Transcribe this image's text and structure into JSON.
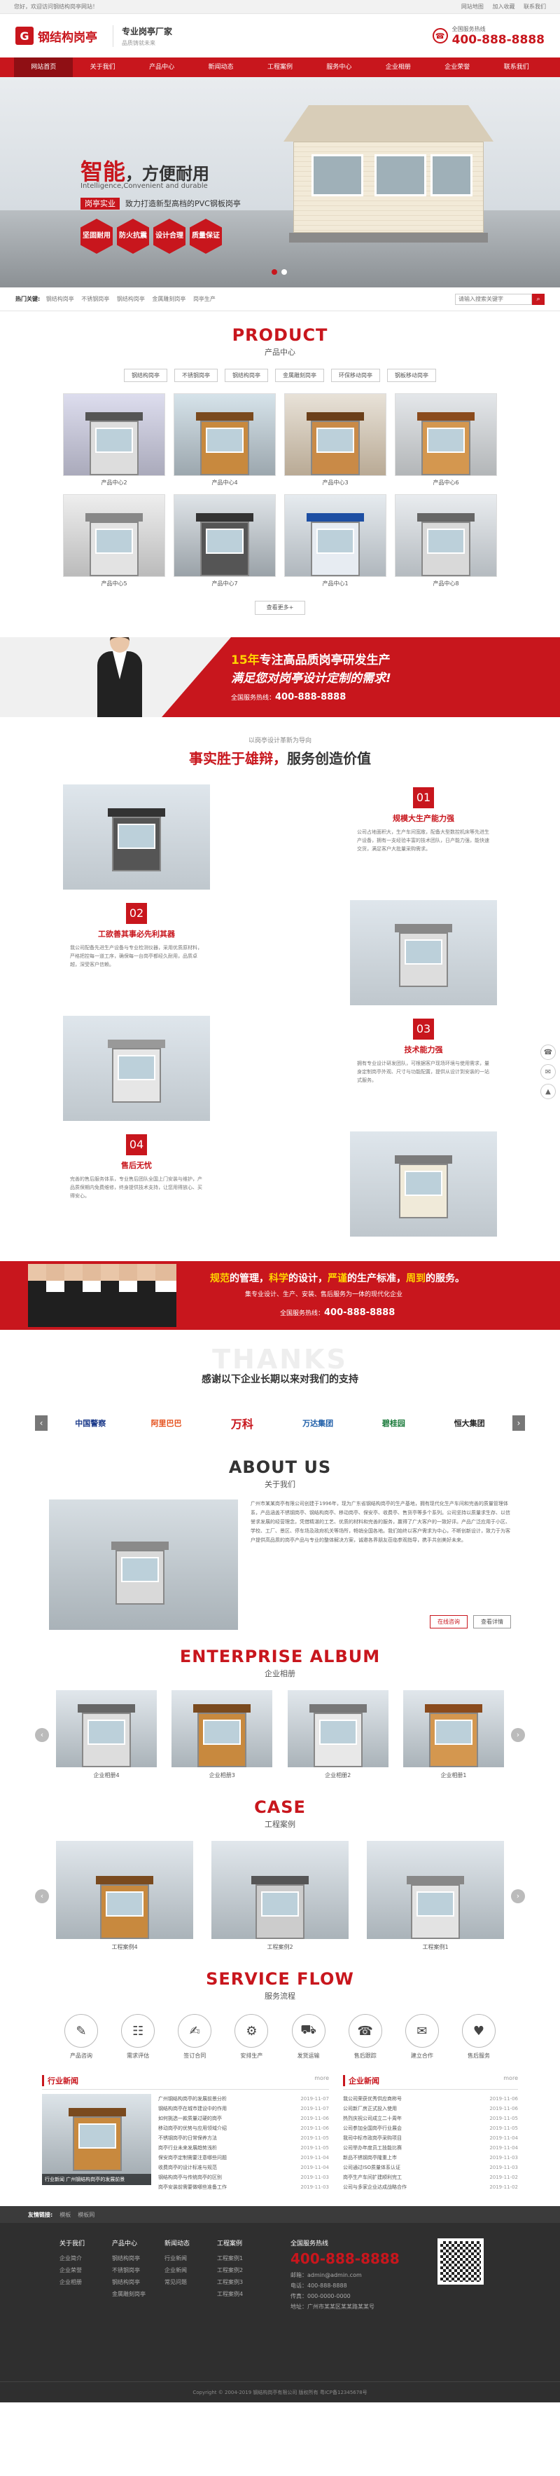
{
  "topbar": {
    "welcome": "您好，欢迎访问钢结构岗亭网站！",
    "links": [
      "网站地图",
      "加入收藏",
      "联系我们"
    ]
  },
  "header": {
    "logo_mark": "G",
    "logo_text": "钢结构岗亭",
    "slogan_a": "专业岗亭厂家",
    "slogan_b": "品质铸就未来",
    "hotline_label": "全国服务热线",
    "hotline": "400-888-8888"
  },
  "nav": [
    "网站首页",
    "关于我们",
    "产品中心",
    "新闻动态",
    "工程案例",
    "服务中心",
    "企业相册",
    "企业荣誉",
    "联系我们"
  ],
  "banner": {
    "title_red": "智能",
    "title_rest": "，方便耐用",
    "sub": "Intelligence,Convenient and durable",
    "tag": "岗亭实业",
    "tag_text": "致力打造新型高档的PVC钢板岗亭",
    "hexes": [
      "坚固耐用",
      "防火抗震",
      "设计合理",
      "质量保证"
    ]
  },
  "hotbar": {
    "label": "热门关键:",
    "keywords": [
      "钢结构岗亭",
      "不锈钢岗亭",
      "钢结构岗亭",
      "金属雕刻岗亭",
      "岗亭生产"
    ],
    "search_placeholder": "请输入搜索关键字"
  },
  "product": {
    "en": "PRODUCT",
    "cn": "产品中心",
    "tabs": [
      "钢结构岗亭",
      "不锈钢岗亭",
      "钢结构岗亭",
      "金属雕刻岗亭",
      "环保移动岗亭",
      "钢板移动岗亭"
    ],
    "items": [
      "产品中心2",
      "产品中心4",
      "产品中心3",
      "产品中心6",
      "产品中心5",
      "产品中心7",
      "产品中心1",
      "产品中心8"
    ],
    "more": "查看更多+"
  },
  "ad1": {
    "years": "15年",
    "l1": "专注高品质岗亭研发生产",
    "l2": "满足您对岗亭设计定制的需求!",
    "label": "全国服务热线：",
    "phone": "400-888-8888"
  },
  "advantage": {
    "sub": "以岗亭设计革新为导向",
    "main_a": "事实胜于雄辩，",
    "main_b": "服务创造价值",
    "items": [
      {
        "num": "01",
        "title": "规模大生产能力强",
        "text": "公司占地面积大，生产车间宽敞，配备大型数控机床等先进生产设备，拥有一支经验丰富的技术团队，日产能力强，能快速交货，满足客户大批量采购需求。"
      },
      {
        "num": "02",
        "title": "工欲善其事必先利其器",
        "text": "我公司配备先进生产设备与专业检测仪器，采用优质原材料，严格把控每一道工序，确保每一台岗亭都经久耐用，品质卓越，深受客户信赖。"
      },
      {
        "num": "03",
        "title": "技术能力强",
        "text": "拥有专业设计研发团队，可根据客户现场环境与使用需求，量身定制岗亭外观、尺寸与功能配置，提供从设计到安装的一站式服务。"
      },
      {
        "num": "04",
        "title": "售后无忧",
        "text": "完善的售后服务体系，专业售后团队全国上门安装与维护，产品质保期内免费维修，终身提供技术支持，让您用得放心、买得安心。"
      }
    ]
  },
  "ad2": {
    "l1a": "规范",
    "l1b": "的管理，",
    "l1c": "科学",
    "l1d": "的设计，",
    "l1e": "严谨",
    "l1f": "的生产标准，",
    "l1g": "周到",
    "l1h": "的服务。",
    "l2": "集专业设计、生产、安装、售后服务为一体的现代化企业",
    "label": "全国服务热线：",
    "phone": "400-888-8888"
  },
  "thanks": {
    "bg": "THANKS",
    "main": "感谢以下企业长期以来对我们的支持",
    "partners": [
      "中国警察",
      "阿里巴巴",
      "万科",
      "万达集团",
      "碧桂园",
      "恒大集团"
    ]
  },
  "about": {
    "en": "ABOUT US",
    "cn": "关于我们",
    "text": "广州市某某岗亭有限公司创建于1996年，现为广东省钢结构岗亭的生产基地，拥有现代化生产车间和完善的质量管理体系，产品涵盖不锈钢岗亭、钢结构岗亭、移动岗亭、保安亭、收费亭、售货亭等多个系列。公司坚持以质量求生存、以信誉求发展的经营理念，凭借精湛的工艺、优质的材料和完善的服务，赢得了广大客户的一致好评。产品广泛应用于小区、学校、工厂、景区、停车场及政府机关等场所，畅销全国各地。我们始终以客户需求为中心，不断创新设计，致力于为客户提供高品质的岗亭产品与专业的整体解决方案，诚邀各界朋友莅临参观指导，携手共创美好未来。",
    "btn1": "在线咨询",
    "btn2": "查看详情"
  },
  "album": {
    "en": "ENTERPRISE ALBUM",
    "cn": "企业相册",
    "items": [
      "企业相册4",
      "企业相册3",
      "企业相册2",
      "企业相册1"
    ]
  },
  "case": {
    "en": "CASE",
    "cn": "工程案例",
    "items": [
      "工程案例4",
      "工程案例2",
      "工程案例1"
    ]
  },
  "flow": {
    "en": "SERVICE FLOW",
    "cn": "服务流程",
    "steps": [
      {
        "icon": "✎",
        "label": "产品咨询"
      },
      {
        "icon": "☷",
        "label": "需求评估"
      },
      {
        "icon": "✍",
        "label": "签订合同"
      },
      {
        "icon": "⚙",
        "label": "安排生产"
      },
      {
        "icon": "⛟",
        "label": "发货运输"
      },
      {
        "icon": "☎",
        "label": "售后跟踪"
      },
      {
        "icon": "✉",
        "label": "建立合作"
      },
      {
        "icon": "♥",
        "label": "售后服务"
      }
    ]
  },
  "news": {
    "h1": "行业新闻",
    "more": "more",
    "caption": "行业新闻 广州钢结构岗亭的发展前景",
    "list1": [
      {
        "t": "广州钢结构岗亭的发展前景分析",
        "d": "2019-11-07"
      },
      {
        "t": "钢结构岗亭在城市建设中的作用",
        "d": "2019-11-07"
      },
      {
        "t": "如何挑选一款质量过硬的岗亭",
        "d": "2019-11-06"
      },
      {
        "t": "移动岗亭的优势与应用领域介绍",
        "d": "2019-11-06"
      },
      {
        "t": "不锈钢岗亭的日常保养方法",
        "d": "2019-11-05"
      },
      {
        "t": "岗亭行业未来发展趋势浅析",
        "d": "2019-11-05"
      },
      {
        "t": "保安岗亭定制需要注意哪些问题",
        "d": "2019-11-04"
      },
      {
        "t": "收费岗亭的设计标准与规范",
        "d": "2019-11-04"
      },
      {
        "t": "钢结构岗亭与传统岗亭的区别",
        "d": "2019-11-03"
      },
      {
        "t": "岗亭安装前需要做哪些准备工作",
        "d": "2019-11-03"
      }
    ],
    "h2": "企业新闻",
    "list2": [
      {
        "t": "我公司荣获优秀供应商称号",
        "d": "2019-11-06"
      },
      {
        "t": "公司新厂房正式投入使用",
        "d": "2019-11-06"
      },
      {
        "t": "热烈庆祝公司成立二十周年",
        "d": "2019-11-05"
      },
      {
        "t": "公司参加全国岗亭行业展会",
        "d": "2019-11-05"
      },
      {
        "t": "我司中标市政岗亭采购项目",
        "d": "2019-11-04"
      },
      {
        "t": "公司举办年度员工技能比赛",
        "d": "2019-11-04"
      },
      {
        "t": "新品不锈钢岗亭隆重上市",
        "d": "2019-11-03"
      },
      {
        "t": "公司通过ISO质量体系认证",
        "d": "2019-11-03"
      },
      {
        "t": "岗亭生产车间扩建顺利完工",
        "d": "2019-11-02"
      },
      {
        "t": "公司与多家企业达成战略合作",
        "d": "2019-11-02"
      }
    ]
  },
  "friends": {
    "label": "友情链接:",
    "links": [
      "模板",
      "模板网"
    ]
  },
  "footer": {
    "cols": [
      {
        "h": "关于我们",
        "items": [
          "企业简介",
          "企业荣誉",
          "企业相册"
        ]
      },
      {
        "h": "产品中心",
        "items": [
          "钢结构岗亭",
          "不锈钢岗亭",
          "钢结构岗亭",
          "金属雕刻岗亭"
        ]
      },
      {
        "h": "新闻动态",
        "items": [
          "行业新闻",
          "企业新闻",
          "常见问题"
        ]
      },
      {
        "h": "工程案例",
        "items": [
          "工程案例1",
          "工程案例2",
          "工程案例3",
          "工程案例4"
        ]
      }
    ],
    "contact_h": "全国服务热线",
    "phone": "400-888-8888",
    "contact": [
      "邮箱：admin@admin.com",
      "电话：400-888-8888",
      "传真：000-0000-0000",
      "地址：广州市某某区某某路某某号"
    ],
    "copyright": "Copyright © 2004-2019 钢结构岗亭有限公司 版权所有 粤ICP备12345678号"
  },
  "float": [
    "☎",
    "✉",
    "▲"
  ]
}
